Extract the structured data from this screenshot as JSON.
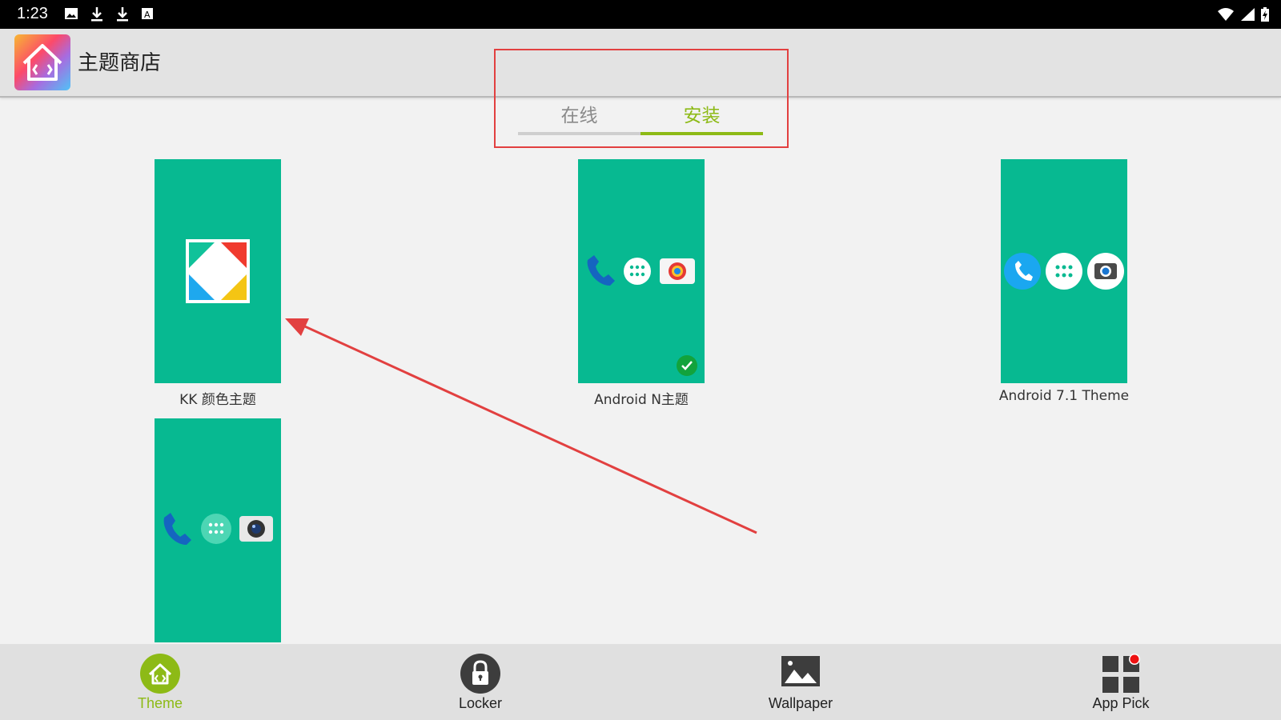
{
  "status_bar": {
    "time": "1:23",
    "left_icons": [
      "image-icon",
      "download-icon",
      "download-icon",
      "keyboard-icon"
    ],
    "right_icons": [
      "wifi-icon",
      "signal-icon",
      "battery-charging-icon"
    ]
  },
  "app_bar": {
    "title": "主题商店",
    "logo_icon": "theme-store-logo-icon"
  },
  "tabs": {
    "items": [
      {
        "label": "在线",
        "selected": false
      },
      {
        "label": "安装",
        "selected": true
      }
    ]
  },
  "themes": [
    {
      "label": "KK 颜色主题",
      "applied": false
    },
    {
      "label": "Android N主题",
      "applied": true
    },
    {
      "label": "Android 7.1 Theme",
      "applied": false
    },
    {
      "label": "",
      "applied": false
    }
  ],
  "bottom_nav": {
    "items": [
      {
        "label": "Theme",
        "icon": "theme-home-icon",
        "active": true
      },
      {
        "label": "Locker",
        "icon": "lock-icon",
        "active": false
      },
      {
        "label": "Wallpaper",
        "icon": "image-icon",
        "active": false
      },
      {
        "label": "App Pick",
        "icon": "apps-grid-icon",
        "active": false,
        "badge": true
      }
    ]
  },
  "colors": {
    "accent": "#8dba16",
    "tile": "#07b991",
    "annotation": "#e24040"
  }
}
